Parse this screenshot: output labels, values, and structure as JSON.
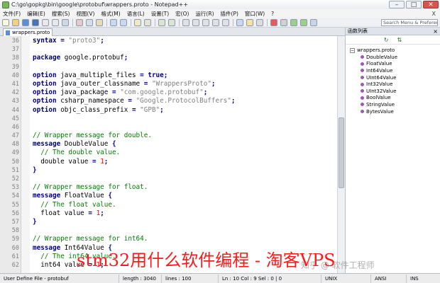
{
  "window": {
    "title": "C:\\go\\gopkg\\bin\\google\\protobuf\\wrappers.proto - Notepad++",
    "minimize": "–",
    "maximize": "□",
    "close": "✕"
  },
  "menu": [
    "文件(F)",
    "编辑(E)",
    "搜索(S)",
    "视图(V)",
    "格式(M)",
    "语言(L)",
    "设置(T)",
    "宏(O)",
    "运行(R)",
    "插件(P)",
    "窗口(W)",
    "?"
  ],
  "menu_close": "X",
  "search": {
    "placeholder": "Search Menu & Preferences"
  },
  "tab": {
    "label": "wrappers.proto"
  },
  "editor": {
    "lines": [
      {
        "n": "36",
        "tokens": [
          [
            "kw",
            "syntax"
          ],
          [
            "id",
            " "
          ],
          [
            "op",
            "="
          ],
          [
            "id",
            " "
          ],
          [
            "str",
            "\"proto3\""
          ],
          [
            "op",
            ";"
          ]
        ]
      },
      {
        "n": "37",
        "tokens": []
      },
      {
        "n": "38",
        "tokens": [
          [
            "kw",
            "package"
          ],
          [
            "id",
            " google.protobuf"
          ],
          [
            "op",
            ";"
          ]
        ]
      },
      {
        "n": "39",
        "tokens": []
      },
      {
        "n": "40",
        "tokens": [
          [
            "kw",
            "option"
          ],
          [
            "id",
            " java_multiple_files "
          ],
          [
            "op",
            "="
          ],
          [
            "id",
            " "
          ],
          [
            "kw",
            "true"
          ],
          [
            "op",
            ";"
          ]
        ]
      },
      {
        "n": "41",
        "tokens": [
          [
            "kw",
            "option"
          ],
          [
            "id",
            " java_outer_classname "
          ],
          [
            "op",
            "="
          ],
          [
            "id",
            " "
          ],
          [
            "str",
            "\"WrappersProto\""
          ],
          [
            "op",
            ";"
          ]
        ]
      },
      {
        "n": "42",
        "tokens": [
          [
            "kw",
            "option"
          ],
          [
            "id",
            " java_package "
          ],
          [
            "op",
            "="
          ],
          [
            "id",
            " "
          ],
          [
            "str",
            "\"com.google.protobuf\""
          ],
          [
            "op",
            ";"
          ]
        ]
      },
      {
        "n": "43",
        "tokens": [
          [
            "kw",
            "option"
          ],
          [
            "id",
            " csharp_namespace "
          ],
          [
            "op",
            "="
          ],
          [
            "id",
            " "
          ],
          [
            "str",
            "\"Google.ProtocolBuffers\""
          ],
          [
            "op",
            ";"
          ]
        ]
      },
      {
        "n": "44",
        "tokens": [
          [
            "kw",
            "option"
          ],
          [
            "id",
            " objc_class_prefix "
          ],
          [
            "op",
            "="
          ],
          [
            "id",
            " "
          ],
          [
            "str",
            "\"GPB\""
          ],
          [
            "op",
            ";"
          ]
        ]
      },
      {
        "n": "45",
        "tokens": []
      },
      {
        "n": "46",
        "tokens": []
      },
      {
        "n": "47",
        "tokens": [
          [
            "cmt",
            "// Wrapper message for double."
          ]
        ]
      },
      {
        "n": "48",
        "tokens": [
          [
            "kw",
            "message"
          ],
          [
            "id",
            " DoubleValue "
          ],
          [
            "op",
            "{"
          ]
        ]
      },
      {
        "n": "49",
        "tokens": [
          [
            "id",
            "  "
          ],
          [
            "cmt",
            "// The double value."
          ]
        ]
      },
      {
        "n": "50",
        "tokens": [
          [
            "id",
            "  double value "
          ],
          [
            "op",
            "="
          ],
          [
            "id",
            " "
          ],
          [
            "num",
            "1"
          ],
          [
            "op",
            ";"
          ]
        ]
      },
      {
        "n": "51",
        "tokens": [
          [
            "op",
            "}"
          ]
        ]
      },
      {
        "n": "52",
        "tokens": []
      },
      {
        "n": "53",
        "tokens": [
          [
            "cmt",
            "// Wrapper message for float."
          ]
        ]
      },
      {
        "n": "54",
        "tokens": [
          [
            "kw",
            "message"
          ],
          [
            "id",
            " FloatValue "
          ],
          [
            "op",
            "{"
          ]
        ]
      },
      {
        "n": "55",
        "tokens": [
          [
            "id",
            "  "
          ],
          [
            "cmt",
            "// The float value."
          ]
        ]
      },
      {
        "n": "56",
        "tokens": [
          [
            "id",
            "  float value "
          ],
          [
            "op",
            "="
          ],
          [
            "id",
            " "
          ],
          [
            "num",
            "1"
          ],
          [
            "op",
            ";"
          ]
        ]
      },
      {
        "n": "57",
        "tokens": [
          [
            "op",
            "}"
          ]
        ]
      },
      {
        "n": "58",
        "tokens": []
      },
      {
        "n": "59",
        "tokens": [
          [
            "cmt",
            "// Wrapper message for int64."
          ]
        ]
      },
      {
        "n": "60",
        "tokens": [
          [
            "kw",
            "message"
          ],
          [
            "id",
            " Int64Value "
          ],
          [
            "op",
            "{"
          ]
        ]
      },
      {
        "n": "61",
        "tokens": [
          [
            "id",
            "  "
          ],
          [
            "cmt",
            "// The int64 value."
          ]
        ]
      },
      {
        "n": "62",
        "tokens": [
          [
            "id",
            "  int64 value "
          ],
          [
            "op",
            "="
          ],
          [
            "id",
            " "
          ],
          [
            "num",
            "1"
          ],
          [
            "op",
            ";"
          ]
        ]
      }
    ]
  },
  "function_list": {
    "header": "函数列表",
    "close": "×",
    "tools": [
      "↻",
      "⇅"
    ],
    "root": "wrappers.proto",
    "items": [
      "DoubleValue",
      "FloatValue",
      "Int64Value",
      "UInt64Value",
      "Int32Value",
      "UInt32Value",
      "BoolValue",
      "StringValue",
      "BytesValue"
    ]
  },
  "status": {
    "file_type": "User Define File - protobuf",
    "length": "length : 3040",
    "lines": "lines : 100",
    "position": "Ln : 10   Col : 9   Sel : 0 | 0",
    "eol": "UNIX",
    "encoding": "ANSI",
    "mode": "INS"
  },
  "watermark": {
    "text": "stm32用什么软件编程 - 淘客VPS"
  },
  "logo_mark": "知乎 @ 软件工程师"
}
